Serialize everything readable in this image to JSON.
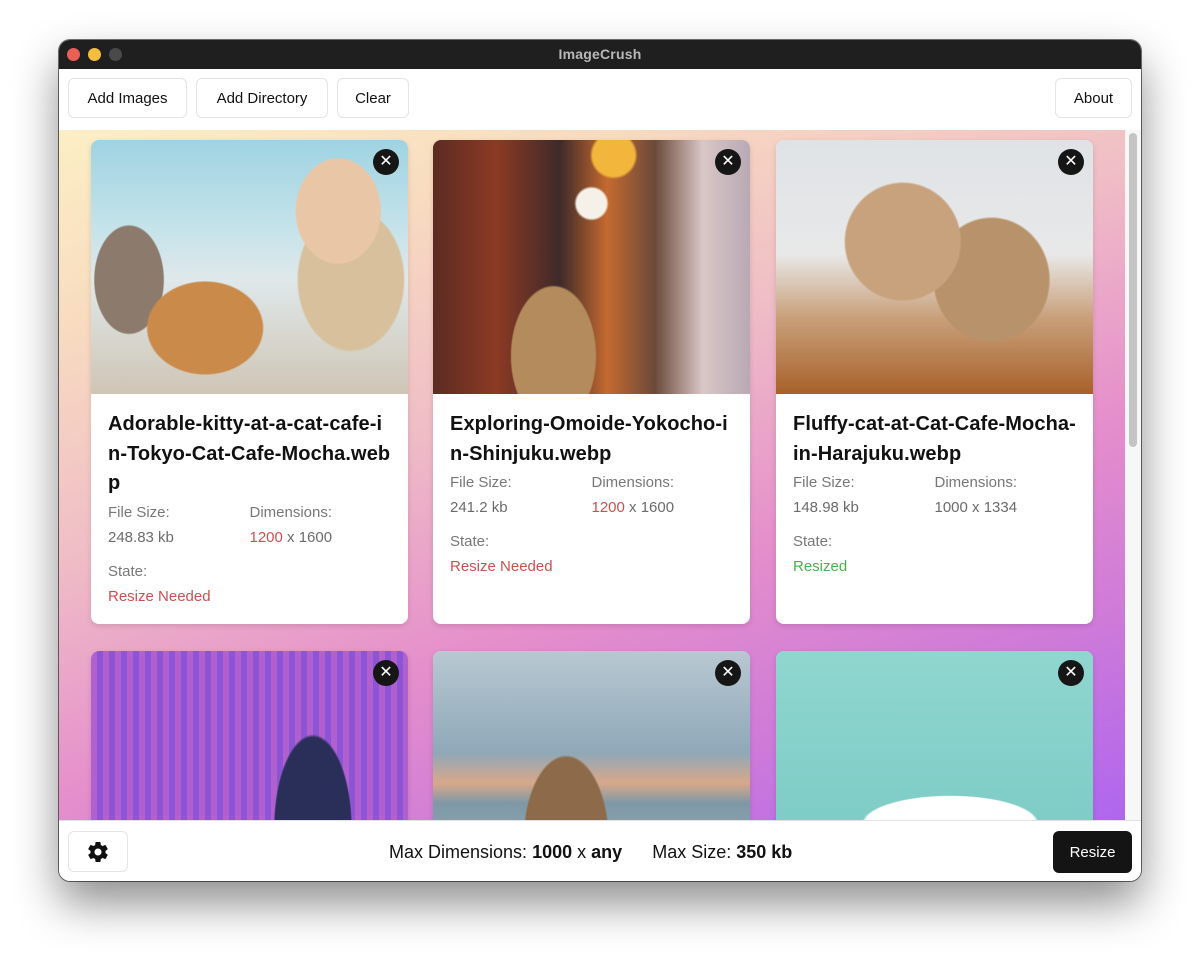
{
  "window": {
    "title": "ImageCrush"
  },
  "toolbar": {
    "add_images_label": "Add Images",
    "add_directory_label": "Add Directory",
    "clear_label": "Clear",
    "about_label": "About"
  },
  "labels": {
    "file_size": "File Size:",
    "dimensions": "Dimensions:",
    "state": "State:",
    "dim_separator": "x",
    "remove_icon": "✕"
  },
  "colors": {
    "needs_resize": "#c9514f",
    "resized": "#4caf50",
    "primary_button": "#141414"
  },
  "images": [
    {
      "filename": "Adorable-kitty-at-a-cat-cafe-in-Tokyo-Cat-Cafe-Mocha.webp",
      "file_size": "248.83 kb",
      "width": "1200",
      "height": "1600",
      "width_exceeds": true,
      "state": "Resize Needed",
      "photo_description": "woman selfie with orange cat"
    },
    {
      "filename": "Exploring-Omoide-Yokocho-in-Shinjuku.webp",
      "file_size": "241.2 kb",
      "width": "1200",
      "height": "1600",
      "width_exceeds": true,
      "state": "Resize Needed",
      "photo_description": "alley with lanterns"
    },
    {
      "filename": "Fluffy-cat-at-Cat-Cafe-Mocha-in-Harajuku.webp",
      "file_size": "148.98 kb",
      "width": "1000",
      "height": "1334",
      "width_exceeds": false,
      "state": "Resized",
      "photo_description": "fluffy cat by window"
    },
    {
      "photo_description": "woman in light installation"
    },
    {
      "photo_description": "woman looking at city view"
    },
    {
      "photo_description": "women around paddleboard in water"
    }
  ],
  "footer": {
    "settings_icon": "gear-icon",
    "max_dimensions_label": "Max Dimensions:",
    "max_width": "1000",
    "dim_separator": "x",
    "max_height": "any",
    "max_size_label": "Max Size:",
    "max_size": "350 kb",
    "resize_label": "Resize"
  },
  "scrollbar": {
    "position_fraction": 0.0,
    "visible_fraction": 0.46
  }
}
